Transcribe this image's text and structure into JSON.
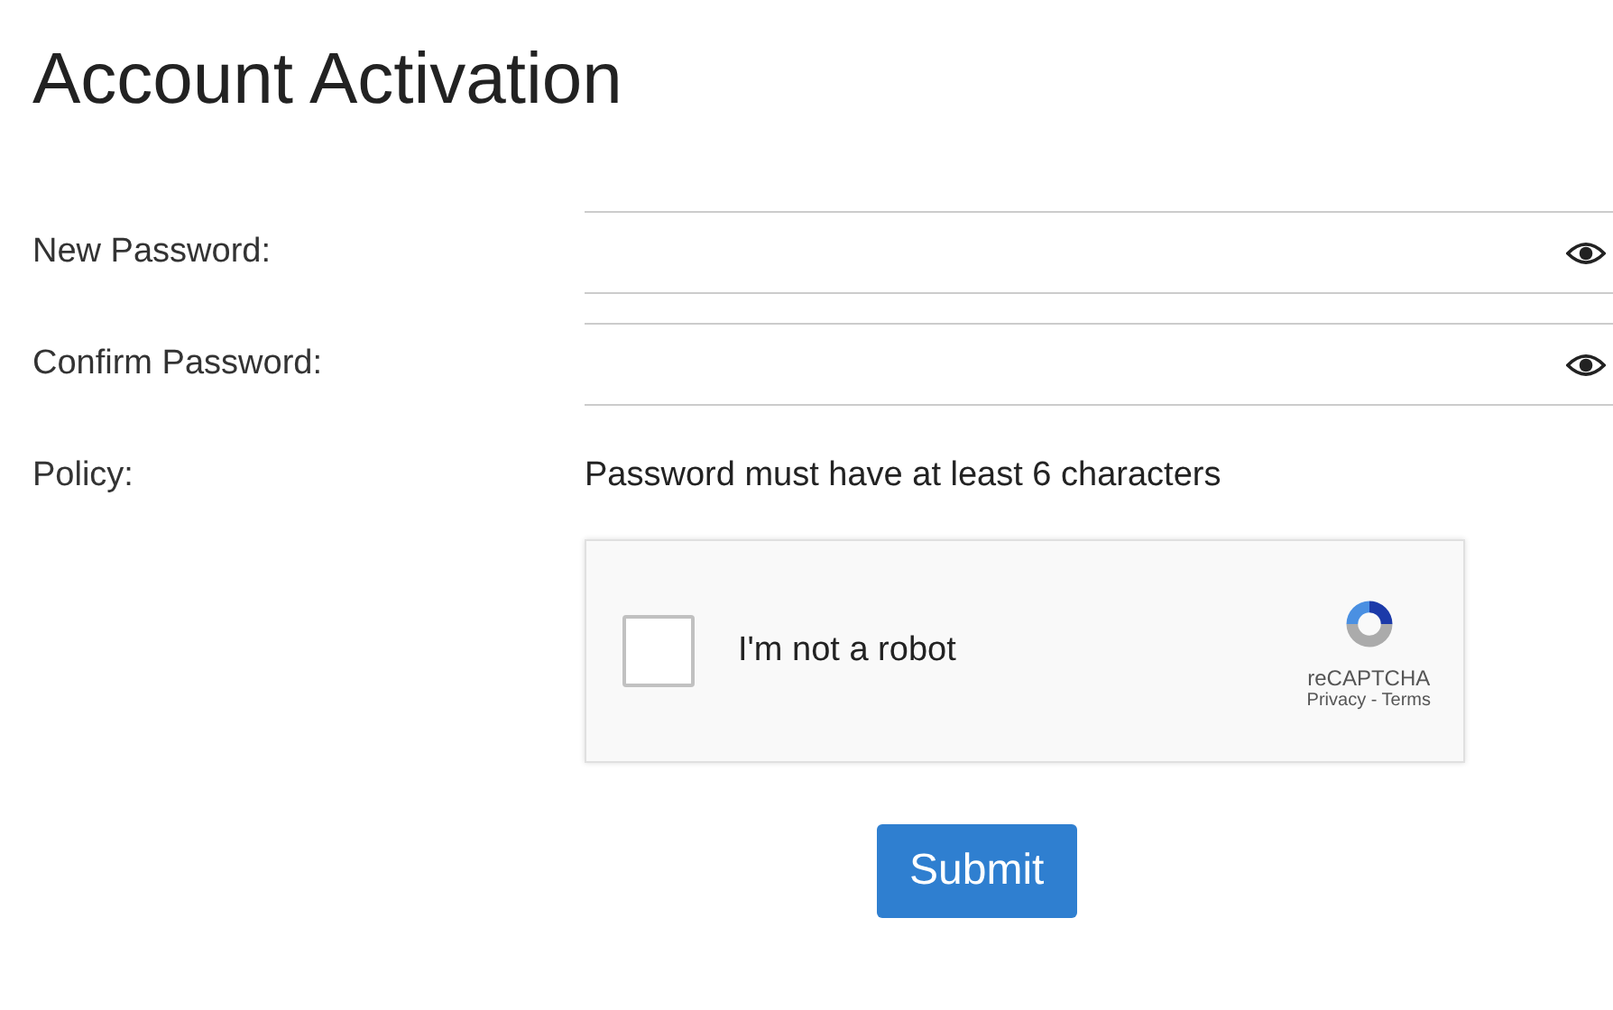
{
  "title": "Account Activation",
  "fields": [
    {
      "label": "New Password:"
    },
    {
      "label": "Confirm Password:"
    }
  ],
  "policy": {
    "label": "Policy:",
    "text": "Password must have at least 6 characters"
  },
  "captcha": {
    "label": "I'm not a robot",
    "checked": false,
    "brand": "reCAPTCHA",
    "links": "Privacy - Terms"
  },
  "submit": "Submit"
}
